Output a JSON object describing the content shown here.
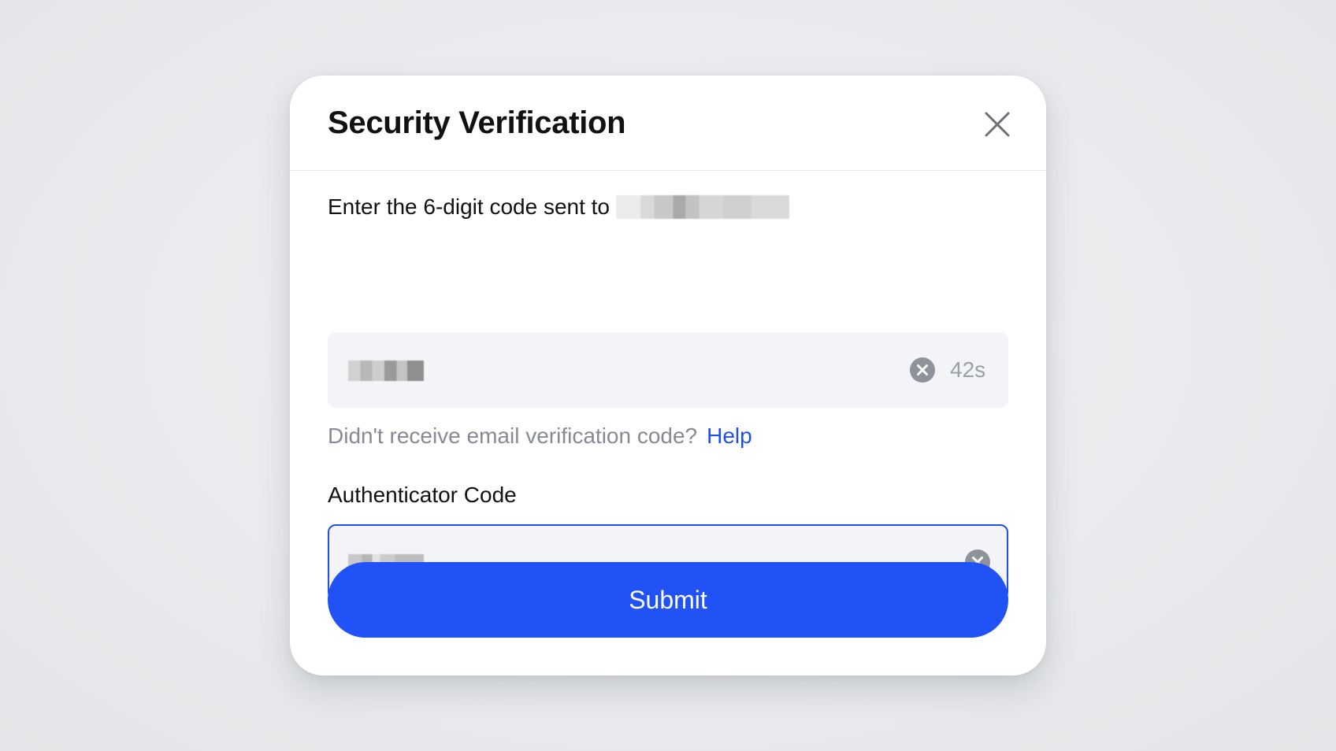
{
  "dialog": {
    "title": "Security Verification"
  },
  "email_field": {
    "label": "Enter the 6-digit code sent to",
    "countdown": "42s"
  },
  "help": {
    "question": "Didn't receive email verification code?",
    "link": "Help"
  },
  "auth_field": {
    "label": "Authenticator Code"
  },
  "submit": {
    "label": "Submit"
  },
  "colors": {
    "primary": "#2152f5",
    "link": "#1f50e9",
    "input_bg": "#f3f4f7",
    "muted_text": "#858a94",
    "focus_border": "#1f50e9"
  },
  "icons": {
    "close": "close-icon",
    "clear": "clear-icon"
  }
}
